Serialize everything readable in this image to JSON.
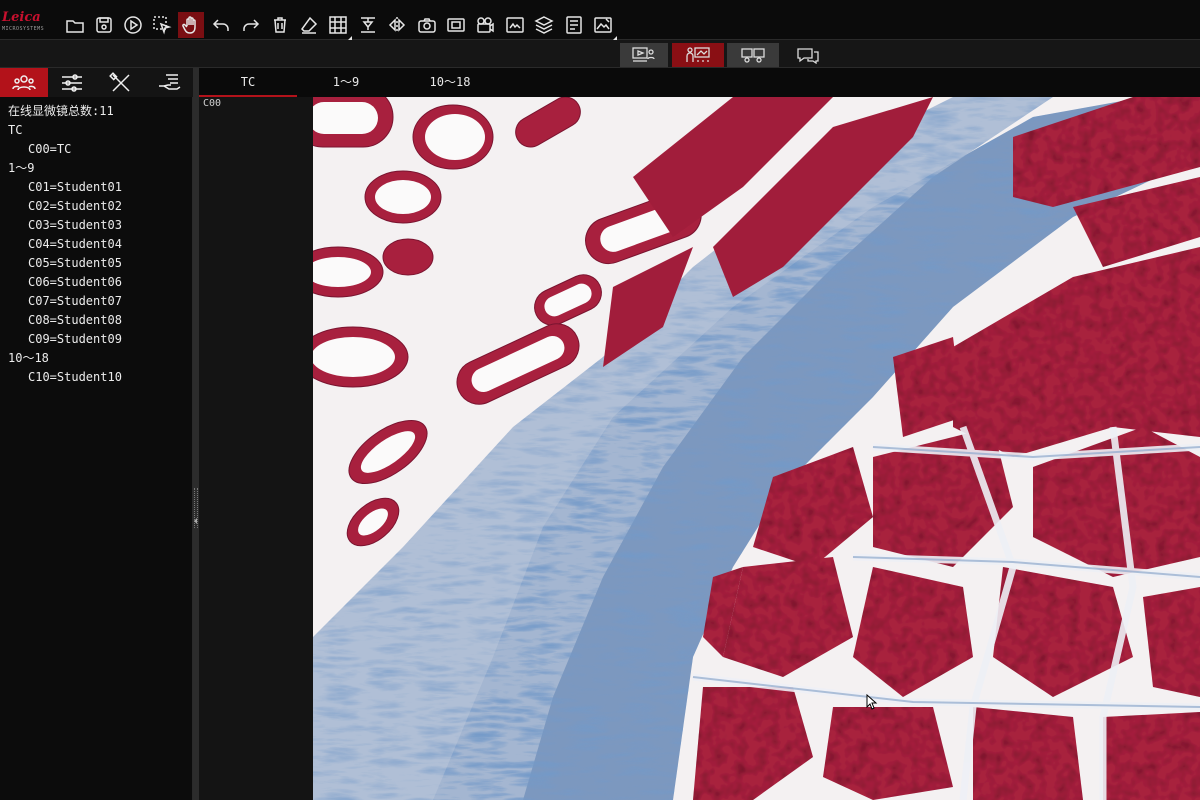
{
  "logo": {
    "brand": "Leica",
    "sub": "MICROSYSTEMS"
  },
  "toolbar": {
    "tools": [
      "open-folder-icon",
      "save-icon",
      "play-icon",
      "select-tool-icon",
      "hand-pan-icon",
      "undo-icon",
      "redo-icon",
      "delete-icon",
      "eraser-icon",
      "grid-icon",
      "measure-calibrate-icon",
      "flip-icon",
      "camera-icon",
      "image-capture-icon",
      "video-record-icon",
      "image-compare-icon",
      "layers-icon",
      "report-icon",
      "image-edit-icon"
    ],
    "active_tool": "hand-pan-icon"
  },
  "modebar": {
    "buttons": [
      "screen-broadcast-icon",
      "teacher-presentation-icon",
      "group-discussion-icon",
      "chat-icon"
    ],
    "active": "teacher-presentation-icon"
  },
  "left_tabs": {
    "items": [
      "students-group-icon",
      "settings-sliders-icon",
      "tools-icon",
      "hand-raise-icon"
    ],
    "active": "students-group-icon"
  },
  "microscope_list": {
    "count_label": "在线显微镜总数:11",
    "groups": [
      {
        "name": "TC",
        "items": [
          "C00=TC"
        ]
      },
      {
        "name": "1～9",
        "items": [
          "C01=Student01",
          "C02=Student02",
          "C03=Student03",
          "C04=Student04",
          "C05=Student05",
          "C06=Student06",
          "C07=Student07",
          "C08=Student08",
          "C09=Student09"
        ]
      },
      {
        "name": "10～18",
        "items": [
          "C10=Student10"
        ]
      }
    ]
  },
  "group_tabs": [
    "TC",
    "1～9",
    "10～18"
  ],
  "active_group_tab": "TC",
  "viewer": {
    "student_label": "C00"
  },
  "colors": {
    "accent": "#b3121a",
    "background": "#111111",
    "tissue_red": "#a8203e",
    "collagen_blue": "#4f76a8"
  }
}
